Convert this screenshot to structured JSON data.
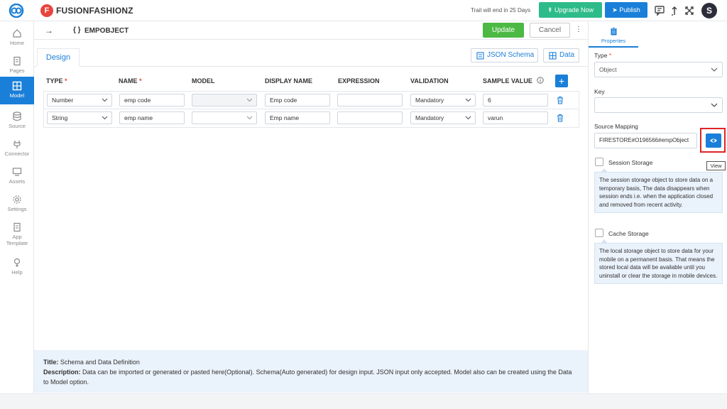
{
  "topbar": {
    "brand_initial": "F",
    "brand_name": "FUSIONFASHIONZ",
    "trail_text": "Trail will end in 25 Days",
    "upgrade_label": "Upgrade Now",
    "publish_label": "Publish",
    "avatar_initial": "S"
  },
  "sidebar": {
    "items": [
      {
        "label": "Home",
        "icon": "home-icon"
      },
      {
        "label": "Pages",
        "icon": "pages-icon"
      },
      {
        "label": "Model",
        "icon": "model-icon",
        "active": true
      },
      {
        "label": "Source",
        "icon": "database-icon"
      },
      {
        "label": "Connector",
        "icon": "plug-icon"
      },
      {
        "label": "Assets",
        "icon": "monitor-icon"
      },
      {
        "label": "Settings",
        "icon": "gear-icon"
      },
      {
        "label": "App",
        "label2": "Template",
        "icon": "template-icon"
      },
      {
        "label": "Help",
        "icon": "help-icon"
      }
    ]
  },
  "header": {
    "object_icon": "{ }",
    "object_name": "EMPOBJECT",
    "update_label": "Update",
    "cancel_label": "Cancel"
  },
  "tabs": {
    "design_label": "Design",
    "json_schema_label": "JSON Schema",
    "data_label": "Data"
  },
  "table": {
    "columns": {
      "type": "TYPE",
      "name": "NAME",
      "model": "MODEL",
      "display_name": "DISPLAY NAME",
      "expression": "EXPRESSION",
      "validation": "VALIDATION",
      "sample_value": "SAMPLE VALUE"
    },
    "required_marker": "*",
    "add_label": "+",
    "rows": [
      {
        "type": "Number",
        "name": "emp code",
        "model": "",
        "display_name": "Emp code",
        "expression": "",
        "validation": "Mandatory",
        "sample_value": "6"
      },
      {
        "type": "String",
        "name": "emp name",
        "model": "",
        "display_name": "Emp name",
        "expression": "",
        "validation": "Mandatory",
        "sample_value": "varun"
      }
    ]
  },
  "footer": {
    "title_label": "Title:",
    "title_text": "Schema and Data Definition",
    "desc_label": "Description:",
    "desc_text": "Data can be imported or generated or pasted here(Optional). Schema(Auto generated) for design input. JSON input only accepted. Model also can be created using the Data to Model option."
  },
  "properties": {
    "tab_label": "Properties",
    "type_label": "Type",
    "type_required": "*",
    "type_value": "Object",
    "key_label": "Key",
    "key_value": "",
    "source_mapping_label": "Source Mapping",
    "source_mapping_value": "FIRESTORE#O196566#empObject",
    "view_tooltip": "View",
    "session_storage_label": "Session Storage",
    "session_storage_desc": "The session storage object to store data on a temporary basis, The data disappears when session ends i.e. when the application closed and removed from recent activity.",
    "cache_storage_label": "Cache Storage",
    "cache_storage_desc": "The local storage object to store data for your mobile on a permanent basis. That means the stored local data will be available until you uninstall or clear the storage in mobile devices."
  },
  "colors": {
    "primary": "#1a7fd8",
    "success": "#4cb944",
    "upgrade": "#2dbb8a",
    "brand": "#e8453c",
    "highlight": "#e02424"
  }
}
